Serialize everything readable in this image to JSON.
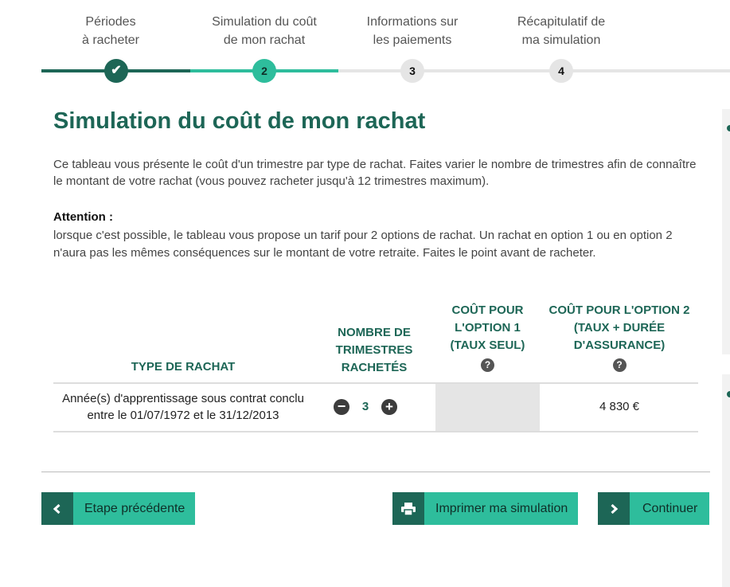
{
  "stepper": {
    "steps": [
      {
        "label_line1": "Périodes",
        "label_line2": "à racheter",
        "marker": "✔",
        "state": "done"
      },
      {
        "label_line1": "Simulation du coût",
        "label_line2": "de mon rachat",
        "marker": "2",
        "state": "current"
      },
      {
        "label_line1": "Informations sur",
        "label_line2": "les paiements",
        "marker": "3",
        "state": "todo"
      },
      {
        "label_line1": "Récapitulatif de",
        "label_line2": "ma simulation",
        "marker": "4",
        "state": "todo"
      }
    ]
  },
  "page": {
    "title": "Simulation du coût de mon rachat",
    "intro": "Ce tableau vous présente le coût d'un trimestre par type de rachat. Faites varier le nombre de trimestres afin de connaître le montant de votre rachat (vous pouvez racheter jusqu'à 12 trimestres maximum).",
    "attention_title": "Attention :",
    "attention_text": "lorsque c'est possible, le tableau vous propose un tarif pour 2 options de rachat. Un rachat en option 1 ou en option 2 n'aura pas les mêmes conséquences sur le montant de votre retraite. Faites le point avant de racheter."
  },
  "table": {
    "headers": {
      "type": "TYPE DE RACHAT",
      "count_l1": "NOMBRE DE",
      "count_l2": "TRIMESTRES",
      "count_l3": "RACHETÉS",
      "opt1_l1": "COÛT POUR",
      "opt1_l2": "L'OPTION 1",
      "opt1_l3": "(TAUX SEUL)",
      "opt2_l1": "COÛT POUR L'OPTION 2",
      "opt2_l2": "(TAUX + DURÉE",
      "opt2_l3": "D'ASSURANCE)",
      "help": "?"
    },
    "rows": [
      {
        "type_l1": "Année(s) d'apprentissage sous contrat conclu",
        "type_l2": "entre le 01/07/1972 et le 31/12/2013",
        "quantity": "3",
        "minus": "−",
        "plus": "+",
        "cost_option1": "",
        "cost_option2": "4 830 €"
      }
    ]
  },
  "actions": {
    "previous_label": "Etape précédente",
    "print_label": "Imprimer ma simulation",
    "continue_label": "Continuer"
  },
  "colors": {
    "primary_dark": "#1d6656",
    "accent": "#2ebd9c",
    "inactive": "#e5e5e5"
  }
}
